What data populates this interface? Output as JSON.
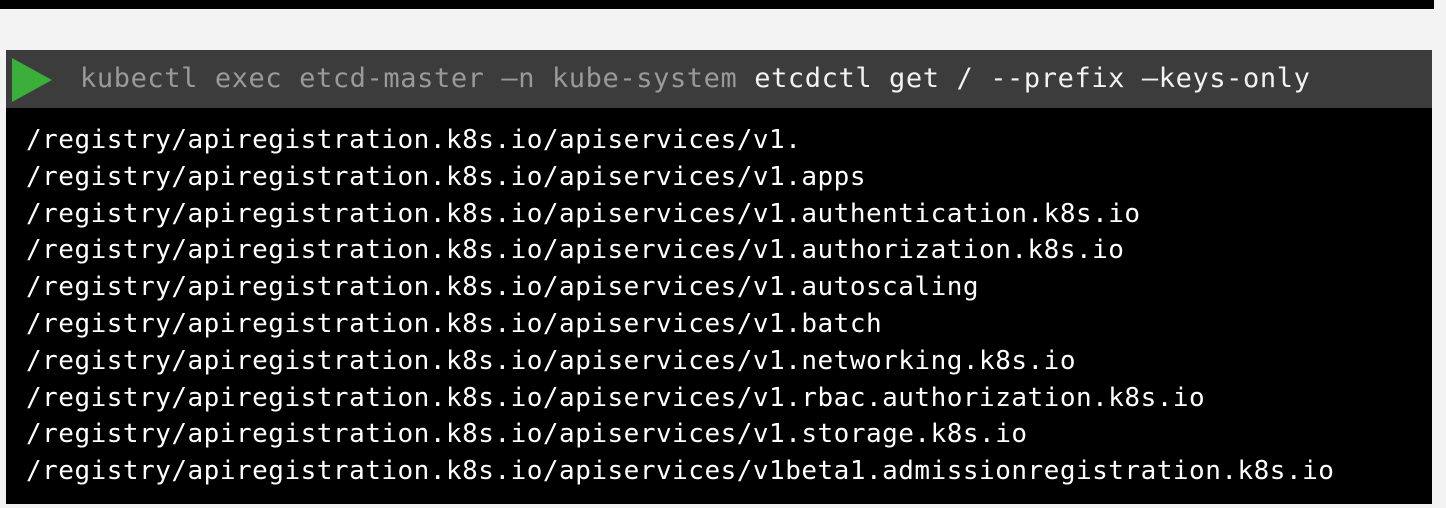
{
  "command": {
    "dim_part": "kubectl exec etcd-master –n kube-system ",
    "bright_part": "etcdctl get / --prefix –keys-only",
    "play_icon": "play-icon",
    "accent_color": "#3cae3c"
  },
  "output": {
    "lines": [
      "/registry/apiregistration.k8s.io/apiservices/v1.",
      "/registry/apiregistration.k8s.io/apiservices/v1.apps",
      "/registry/apiregistration.k8s.io/apiservices/v1.authentication.k8s.io",
      "/registry/apiregistration.k8s.io/apiservices/v1.authorization.k8s.io",
      "/registry/apiregistration.k8s.io/apiservices/v1.autoscaling",
      "/registry/apiregistration.k8s.io/apiservices/v1.batch",
      "/registry/apiregistration.k8s.io/apiservices/v1.networking.k8s.io",
      "/registry/apiregistration.k8s.io/apiservices/v1.rbac.authorization.k8s.io",
      "/registry/apiregistration.k8s.io/apiservices/v1.storage.k8s.io",
      "/registry/apiregistration.k8s.io/apiservices/v1beta1.admissionregistration.k8s.io"
    ]
  }
}
